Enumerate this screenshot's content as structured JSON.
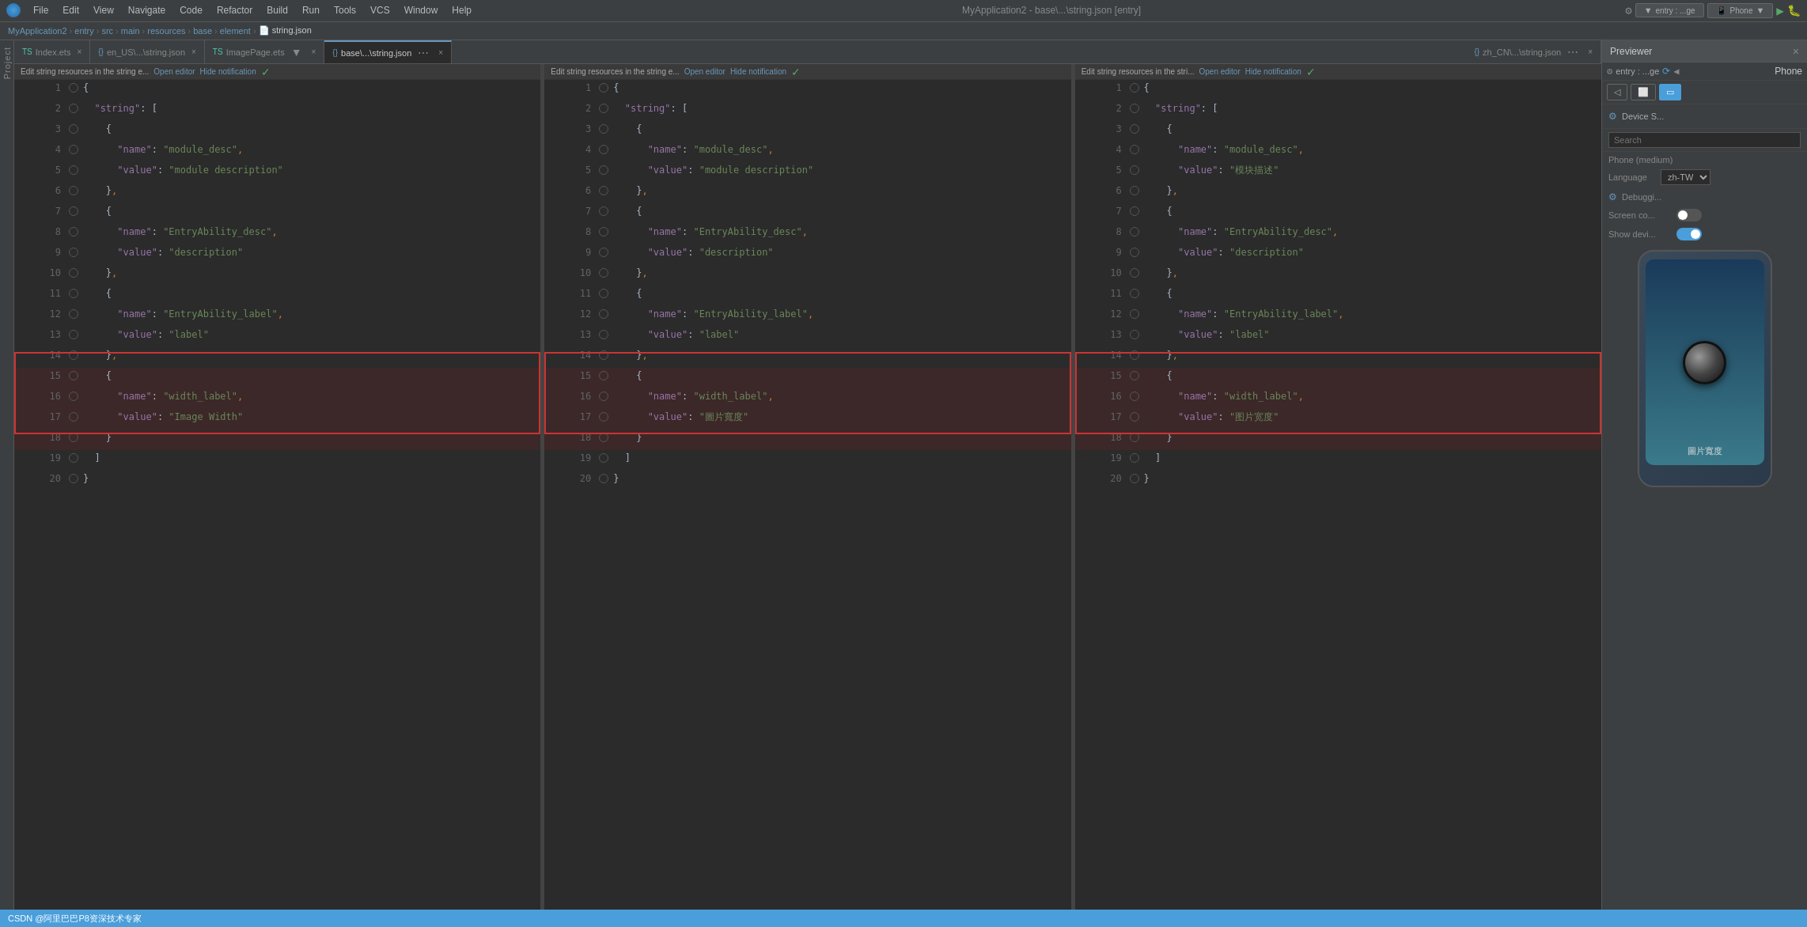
{
  "app": {
    "title": "MyApplication2 - base\\...\\string.json [entry]",
    "logo": "🔴"
  },
  "menu": {
    "items": [
      "File",
      "Edit",
      "View",
      "Navigate",
      "Code",
      "Refactor",
      "Build",
      "Run",
      "Tools",
      "VCS",
      "Window",
      "Help"
    ]
  },
  "breadcrumb": {
    "parts": [
      "MyApplication2",
      "entry",
      "src",
      "main",
      "resources",
      "base",
      "element",
      "string.json"
    ]
  },
  "tabs": {
    "items": [
      {
        "label": "Index.ets",
        "active": false,
        "icon": "ts"
      },
      {
        "label": "en_US\\...\\string.json",
        "active": false,
        "icon": "json"
      },
      {
        "label": "ImagePage.ets",
        "active": false,
        "icon": "ts"
      },
      {
        "label": "base\\...\\string.json",
        "active": true,
        "icon": "json"
      },
      {
        "label": "zh_CN\\...\\string.json",
        "active": false,
        "icon": "json"
      }
    ]
  },
  "editor_panes": [
    {
      "id": "pane1",
      "tab_label": "en_US\\...\\string.json",
      "notification": "Edit string resources in the string e...",
      "open_editor": "Open editor",
      "hide_notification": "Hide notification",
      "lines": [
        {
          "num": 1,
          "content": "{",
          "gutter": false
        },
        {
          "num": 2,
          "content": "  \"string\": [",
          "gutter": false
        },
        {
          "num": 3,
          "content": "    {",
          "gutter": false
        },
        {
          "num": 4,
          "content": "      \"name\": \"module_desc\",",
          "gutter": false
        },
        {
          "num": 5,
          "content": "      \"value\": \"module description\"",
          "gutter": false
        },
        {
          "num": 6,
          "content": "    },",
          "gutter": false
        },
        {
          "num": 7,
          "content": "    {",
          "gutter": false
        },
        {
          "num": 8,
          "content": "      \"name\": \"EntryAbility_desc\",",
          "gutter": false
        },
        {
          "num": 9,
          "content": "      \"value\": \"description\"",
          "gutter": false
        },
        {
          "num": 10,
          "content": "    },",
          "gutter": false
        },
        {
          "num": 11,
          "content": "    {",
          "gutter": false
        },
        {
          "num": 12,
          "content": "      \"name\": \"EntryAbility_label\",",
          "gutter": false
        },
        {
          "num": 13,
          "content": "      \"value\": \"label\"",
          "gutter": false
        },
        {
          "num": 14,
          "content": "    },",
          "gutter": false
        },
        {
          "num": 15,
          "content": "    {",
          "gutter": false,
          "highlight": true
        },
        {
          "num": 16,
          "content": "      \"name\": \"width_label\",",
          "gutter": false,
          "highlight": true
        },
        {
          "num": 17,
          "content": "      \"value\": \"Image Width\"",
          "gutter": false,
          "highlight": true
        },
        {
          "num": 18,
          "content": "    }",
          "gutter": false,
          "highlight": true
        },
        {
          "num": 19,
          "content": "  ]",
          "gutter": false
        },
        {
          "num": 20,
          "content": "}",
          "gutter": false
        }
      ]
    },
    {
      "id": "pane2",
      "tab_label": "base\\...\\string.json",
      "notification": "Edit string resources in the string e...",
      "open_editor": "Open editor",
      "hide_notification": "Hide notification",
      "lines": [
        {
          "num": 1,
          "content": "{",
          "gutter": false
        },
        {
          "num": 2,
          "content": "  \"string\": [",
          "gutter": false
        },
        {
          "num": 3,
          "content": "    {",
          "gutter": false
        },
        {
          "num": 4,
          "content": "      \"name\": \"module_desc\",",
          "gutter": false
        },
        {
          "num": 5,
          "content": "      \"value\": \"module description\"",
          "gutter": false
        },
        {
          "num": 6,
          "content": "    },",
          "gutter": false
        },
        {
          "num": 7,
          "content": "    {",
          "gutter": false
        },
        {
          "num": 8,
          "content": "      \"name\": \"EntryAbility_desc\",",
          "gutter": false
        },
        {
          "num": 9,
          "content": "      \"value\": \"description\"",
          "gutter": false
        },
        {
          "num": 10,
          "content": "    },",
          "gutter": false
        },
        {
          "num": 11,
          "content": "    {",
          "gutter": false
        },
        {
          "num": 12,
          "content": "      \"name\": \"EntryAbility_label\",",
          "gutter": false
        },
        {
          "num": 13,
          "content": "      \"value\": \"label\"",
          "gutter": false
        },
        {
          "num": 14,
          "content": "    },",
          "gutter": false
        },
        {
          "num": 15,
          "content": "    {",
          "gutter": false,
          "highlight": true
        },
        {
          "num": 16,
          "content": "      \"name\": \"width_label\",",
          "gutter": false,
          "highlight": true
        },
        {
          "num": 17,
          "content": "      \"value\": \"圖片寬度\"",
          "gutter": false,
          "highlight": true
        },
        {
          "num": 18,
          "content": "    }",
          "gutter": false,
          "highlight": true
        },
        {
          "num": 19,
          "content": "  ]",
          "gutter": false
        },
        {
          "num": 20,
          "content": "}",
          "gutter": false
        }
      ]
    },
    {
      "id": "pane3",
      "tab_label": "zh_CN\\...\\string.json",
      "notification": "Edit string resources in the stri...",
      "open_editor": "Open editor",
      "hide_notification": "Hide notification",
      "lines": [
        {
          "num": 1,
          "content": "{",
          "gutter": false
        },
        {
          "num": 2,
          "content": "  \"string\": [",
          "gutter": false
        },
        {
          "num": 3,
          "content": "    {",
          "gutter": false
        },
        {
          "num": 4,
          "content": "      \"name\": \"module_desc\",",
          "gutter": false
        },
        {
          "num": 5,
          "content": "      \"value\": \"模块描述\"",
          "gutter": false
        },
        {
          "num": 6,
          "content": "    },",
          "gutter": false
        },
        {
          "num": 7,
          "content": "    {",
          "gutter": false
        },
        {
          "num": 8,
          "content": "      \"name\": \"EntryAbility_desc\",",
          "gutter": false
        },
        {
          "num": 9,
          "content": "      \"value\": \"description\"",
          "gutter": false
        },
        {
          "num": 10,
          "content": "    },",
          "gutter": false
        },
        {
          "num": 11,
          "content": "    {",
          "gutter": false
        },
        {
          "num": 12,
          "content": "      \"name\": \"EntryAbility_label\",",
          "gutter": false
        },
        {
          "num": 13,
          "content": "      \"value\": \"label\"",
          "gutter": false
        },
        {
          "num": 14,
          "content": "    },",
          "gutter": false
        },
        {
          "num": 15,
          "content": "    {",
          "gutter": false,
          "highlight": true
        },
        {
          "num": 16,
          "content": "      \"name\": \"width_label\",",
          "gutter": false,
          "highlight": true
        },
        {
          "num": 17,
          "content": "      \"value\": \"图片宽度\"",
          "gutter": false,
          "highlight": true
        },
        {
          "num": 18,
          "content": "    }",
          "gutter": false,
          "highlight": true
        },
        {
          "num": 19,
          "content": "  ]",
          "gutter": false
        },
        {
          "num": 20,
          "content": "}",
          "gutter": false
        }
      ]
    }
  ],
  "previewer": {
    "title": "Previewer",
    "entry_label": "entry : ...ge",
    "phone_label": "Phone",
    "device_label": "Phone (medium)",
    "search_placeholder": "Search",
    "language_label": "Language",
    "language_value": "zh-TW",
    "debugger_label": "Debuggi...",
    "screen_color_label": "Screen co...",
    "show_device_label": "Show devi...",
    "phone_image_label": "圖片寬度",
    "show_device_toggle": true
  },
  "status_bar": {
    "text": "CSDN @阿里巴巴P8资深技术专家"
  }
}
